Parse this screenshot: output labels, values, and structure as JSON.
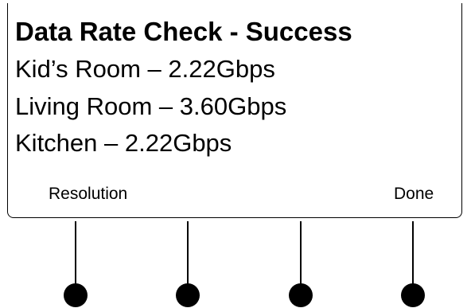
{
  "screen": {
    "title": "Data Rate Check - Success",
    "lines": [
      {
        "text": "Kid’s Room – 2.22Gbps"
      },
      {
        "text": "Living Room – 3.60Gbps"
      },
      {
        "text": "Kitchen – 2.22Gbps"
      }
    ],
    "softkeys": {
      "left_label": "Resolution",
      "right_label": "Done"
    }
  },
  "hardware_buttons": {
    "count": 4
  },
  "colors": {
    "background": "#ffffff",
    "foreground": "#000000"
  }
}
